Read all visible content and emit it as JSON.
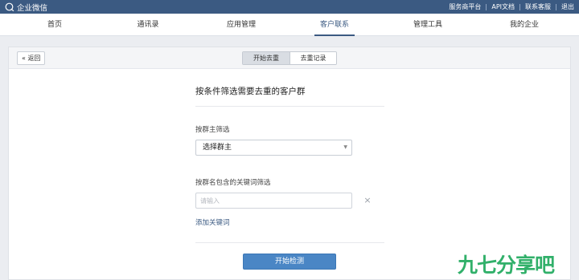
{
  "header": {
    "brand": "企业微信",
    "links": [
      "服务商平台",
      "API文档",
      "联系客服",
      "退出"
    ]
  },
  "nav": {
    "items": [
      "首页",
      "通讯录",
      "应用管理",
      "客户联系",
      "管理工具",
      "我的企业"
    ],
    "active_index": 3
  },
  "subbar": {
    "back_label": "« 返回",
    "tabs": [
      "开始去重",
      "去重记录"
    ],
    "active_tab": 0
  },
  "form": {
    "title": "按条件筛选需要去重的客户群",
    "owner_label": "按群主筛选",
    "owner_select_value": "选择群主",
    "keyword_label": "按群名包含的关键词筛选",
    "keyword_placeholder": "请输入",
    "keyword_value": "",
    "add_keyword": "添加关键词",
    "submit": "开始检测"
  },
  "watermark": "九七分享吧",
  "colors": {
    "topbar": "#3b5a82",
    "accent": "#3b5a82",
    "primary_button": "#4a86c5",
    "watermark": "#31b06a",
    "page_background": "#ebedf1"
  }
}
